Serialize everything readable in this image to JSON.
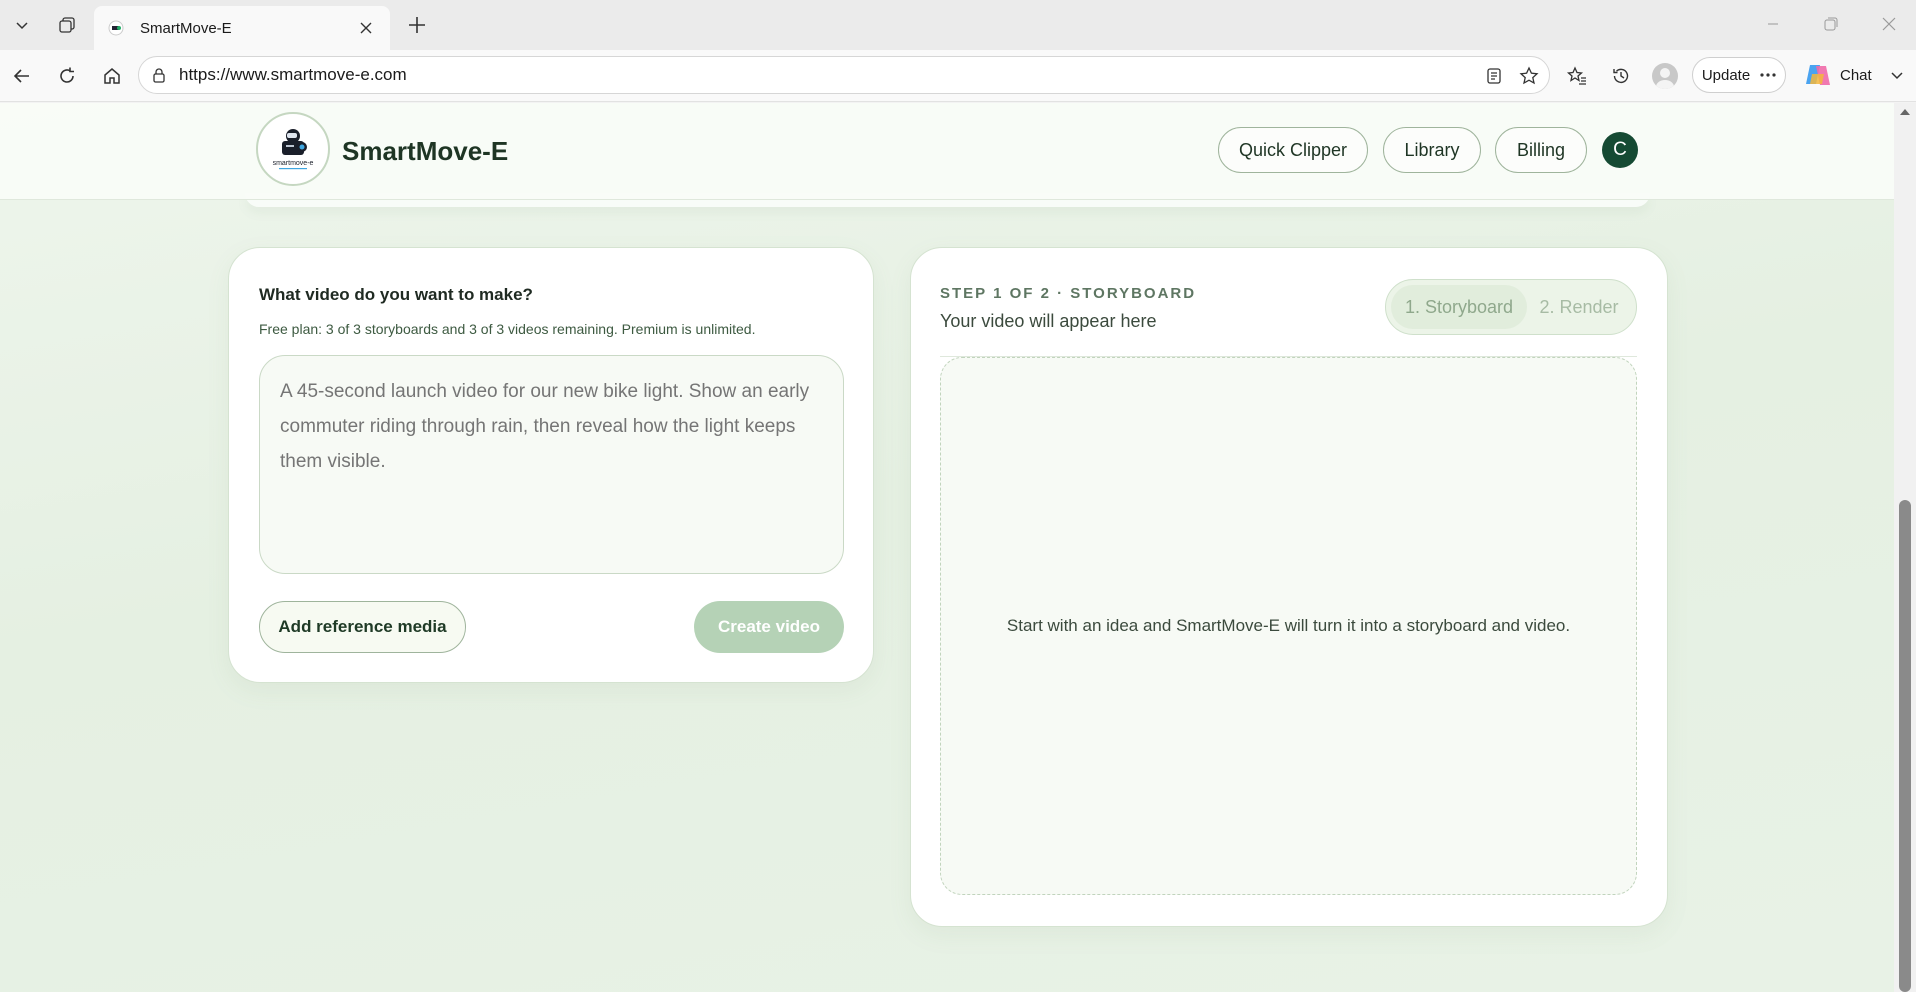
{
  "browser": {
    "tab_title": "SmartMove-E",
    "url": "https://www.smartmove-e.com",
    "update_label": "Update",
    "chat_label": "Chat"
  },
  "header": {
    "brand": "SmartMove-E",
    "logo_text": "smartmove-e",
    "nav": [
      "Quick Clipper",
      "Library",
      "Billing"
    ],
    "avatar_initial": "C"
  },
  "create": {
    "title": "What video do you want to make?",
    "plan_note": "Free plan: 3 of 3 storyboards and 3 of 3 videos remaining. Premium is unlimited.",
    "prompt_placeholder": "A 45-second launch video for our new bike light. Show an early commuter riding through rain, then reveal how the light keeps them visible.",
    "reference_button": "Add reference media",
    "create_button": "Create video"
  },
  "preview": {
    "step_label": "STEP 1 OF 2 · STORYBOARD",
    "subtitle": "Your video will appear here",
    "steps": [
      "1. Storyboard",
      "2. Render"
    ],
    "active_step": 0,
    "empty_message": "Start with an idea and SmartMove-E will turn it into a storyboard and video."
  },
  "colors": {
    "brand_dark": "#154a33",
    "accent_green": "#b5d2b6",
    "page_bg": "#e8f2e6"
  }
}
